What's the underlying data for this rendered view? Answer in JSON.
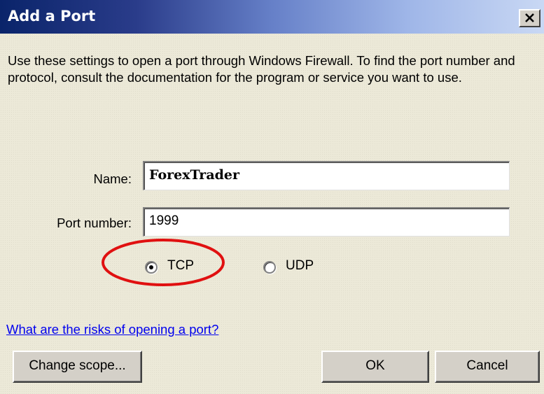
{
  "window": {
    "title": "Add a Port",
    "close_icon": "close-icon"
  },
  "description": "Use these settings to open a port through Windows Firewall. To find the port number and protocol, consult the documentation for the program or service you want to use.",
  "form": {
    "name_label": "Name:",
    "name_value": "ForexTrader",
    "port_label": "Port number:",
    "port_value": "1999"
  },
  "protocol": {
    "options": [
      {
        "label": "TCP",
        "selected": true
      },
      {
        "label": "UDP",
        "selected": false
      }
    ],
    "highlight_color": "#e01010"
  },
  "link_text": "What are the risks of opening a port?",
  "buttons": {
    "change_scope": "Change scope...",
    "ok": "OK",
    "cancel": "Cancel"
  }
}
